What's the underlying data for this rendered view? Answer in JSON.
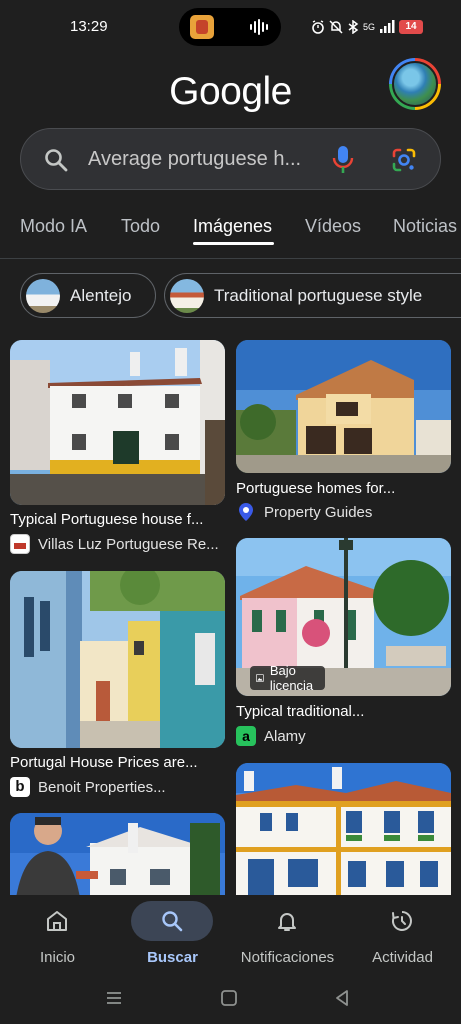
{
  "status_bar": {
    "time": "13:29",
    "network": "5G",
    "battery": "14"
  },
  "header": {
    "logo": "Google",
    "avatar_icon": "profile-avatar"
  },
  "search": {
    "query": "Average portuguese h...",
    "icons": [
      "search-icon",
      "mic-icon",
      "lens-icon"
    ]
  },
  "tabs": [
    {
      "label": "Modo IA"
    },
    {
      "label": "Todo"
    },
    {
      "label": "Imágenes",
      "active": true
    },
    {
      "label": "Vídeos"
    },
    {
      "label": "Noticias"
    }
  ],
  "chips": [
    {
      "label": "Alentejo"
    },
    {
      "label": "Traditional portuguese style"
    }
  ],
  "results": [
    {
      "title": "Typical Portuguese house f...",
      "source": "Villas Luz Portuguese Re..."
    },
    {
      "title": "Portuguese homes for...",
      "source": "Property Guides"
    },
    {
      "title": "Typical traditional...",
      "source": "Alamy",
      "badge": "Bajo licencia"
    },
    {
      "title": "Portugal House Prices are...",
      "source": "Benoit Properties..."
    }
  ],
  "bottom_nav": [
    {
      "label": "Inicio",
      "icon": "home-icon"
    },
    {
      "label": "Buscar",
      "icon": "search-icon",
      "active": true
    },
    {
      "label": "Notificaciones",
      "icon": "bell-icon"
    },
    {
      "label": "Actividad",
      "icon": "history-icon"
    }
  ],
  "colors": {
    "background": "#1f1f1f",
    "search_box": "#303134",
    "active_nav": "#a8c7fa",
    "active_pill": "#3c4555"
  }
}
